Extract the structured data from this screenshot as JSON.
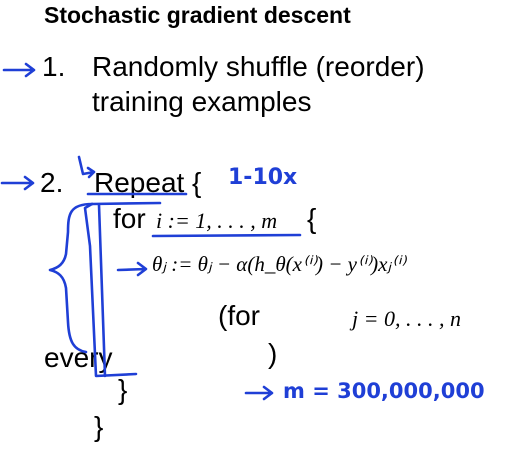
{
  "slide": {
    "title": "Stochastic gradient descent",
    "step1": {
      "number": "1.",
      "line1": "Randomly shuffle (reorder)",
      "line2": "training examples"
    },
    "step2": {
      "number": "2.",
      "repeat": "Repeat",
      "open_brace": "{",
      "for_keyword": "for",
      "for_range": "i := 1, . . . , m",
      "for_brace": "{",
      "update_rule": "θⱼ := θⱼ − α(h_θ(x⁽ⁱ⁾) − y⁽ⁱ⁾)xⱼ⁽ⁱ⁾",
      "for_every_open": "(for",
      "for_every_range": "j = 0, . . . , n",
      "every_word": "every",
      "close_paren": ")",
      "inner_close": "}",
      "outer_close": "}"
    }
  },
  "annotations": {
    "repeat_count": "1-10x",
    "m_value": "m = 300,000,000",
    "ink_color": "#1f3fd6"
  }
}
